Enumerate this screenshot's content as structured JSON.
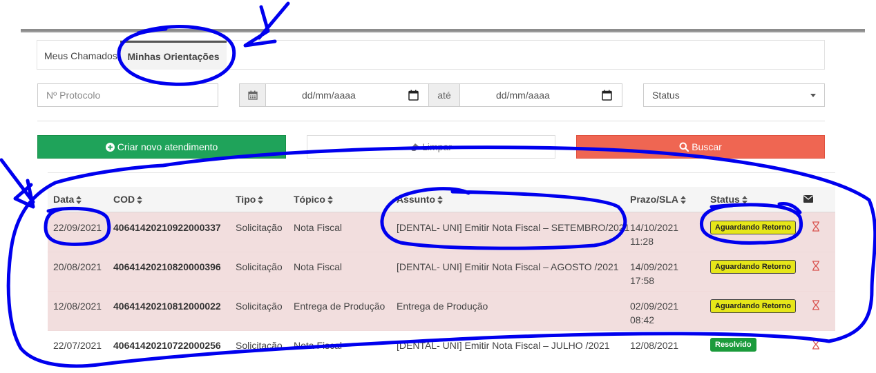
{
  "tabs": [
    {
      "label": "Meus Chamados"
    },
    {
      "label": "Minhas Orientações"
    }
  ],
  "filters": {
    "protocol_placeholder": "Nº Protocolo",
    "date_from": "dd/mm/aaaa",
    "until_label": "até",
    "date_to": "dd/mm/aaaa",
    "status_label": "Status"
  },
  "buttons": {
    "create": "Criar novo atendimento",
    "clear": "Limpar",
    "search": "Buscar"
  },
  "table": {
    "headers": {
      "data": "Data",
      "cod": "COD",
      "tipo": "Tipo",
      "topico": "Tópico",
      "assunto": "Assunto",
      "prazo": "Prazo/SLA",
      "status": "Status"
    },
    "rows": [
      {
        "data": "22/09/2021",
        "cod": "40641420210922000337",
        "tipo": "Solicitação",
        "topico": "Nota Fiscal",
        "assunto": "[DENTAL- UNI] Emitir Nota Fiscal – SETEMBRO/2021",
        "prazo_date": "14/10/2021",
        "prazo_time": "11:28",
        "status": "Aguardando Retorno"
      },
      {
        "data": "20/08/2021",
        "cod": "40641420210820000396",
        "tipo": "Solicitação",
        "topico": "Nota Fiscal",
        "assunto": "[DENTAL- UNI] Emitir Nota Fiscal – AGOSTO /2021",
        "prazo_date": "14/09/2021",
        "prazo_time": "17:58",
        "status": "Aguardando Retorno"
      },
      {
        "data": "12/08/2021",
        "cod": "40641420210812000022",
        "tipo": "Solicitação",
        "topico": "Entrega de Produção",
        "assunto": "Entrega de Produção",
        "prazo_date": "02/09/2021",
        "prazo_time": "08:42",
        "status": "Aguardando Retorno"
      },
      {
        "data": "22/07/2021",
        "cod": "40641420210722000256",
        "tipo": "Solicitação",
        "topico": "Nota Fiscal",
        "assunto": "[DENTAL- UNI] Emitir Nota Fiscal – JULHO /2021",
        "prazo_date": "12/08/2021",
        "prazo_time": "",
        "status": "Resolvido"
      }
    ]
  },
  "colors": {
    "create": "#1fa35a",
    "search": "#ef6652",
    "row_pending": "#f2dede",
    "badge_waiting": "#e6e619",
    "badge_resolved": "#1b9b3b",
    "annotation": "#0000ee"
  }
}
